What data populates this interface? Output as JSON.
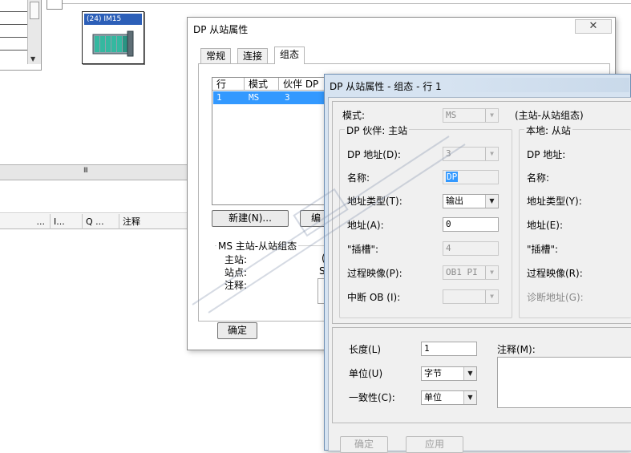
{
  "background": {
    "module_label": "(24) IM15",
    "scroll_grip": "III",
    "table_headers": [
      "...",
      "I...",
      "Q ...",
      "注释"
    ]
  },
  "dp_dialog": {
    "title": "DP 从站属性",
    "close_glyph": "✕",
    "tabs": [
      "常规",
      "连接",
      "组态"
    ],
    "active_tab": "组态",
    "table": {
      "headers": [
        "行",
        "模式",
        "伙伴 DP"
      ],
      "rows": [
        [
          "1",
          "MS",
          "3"
        ]
      ]
    },
    "new_button": "新建(N)...",
    "edit_button": "编",
    "ms_group": {
      "title": "MS 主站-从站组态",
      "master_label": "主站:",
      "station_label": "站点:",
      "comment_label": "注释:",
      "master_value_partial": "(",
      "station_value_partial": "S"
    },
    "ok_button": "确定"
  },
  "row_dialog": {
    "title": "DP 从站属性 - 组态 - 行 1",
    "mode": {
      "label": "模式:",
      "value": "MS",
      "hint": "(主站-从站组态)"
    },
    "dp_partner_group": {
      "title": "DP 伙伴: 主站",
      "dp_address": {
        "label": "DP 地址(D):",
        "value": "3"
      },
      "name": {
        "label": "名称:",
        "value": "DP"
      },
      "address_type": {
        "label": "地址类型(T):",
        "value": "输出"
      },
      "address": {
        "label": "地址(A):",
        "value": "0"
      },
      "slot": {
        "label": "\"插槽\":",
        "value": "4"
      },
      "process_image": {
        "label": "过程映像(P):",
        "value": "OB1 PI"
      },
      "interrupt_ob": {
        "label": "中断 OB (I):",
        "value": ""
      }
    },
    "local_group": {
      "title": "本地: 从站",
      "dp_address_label": "DP 地址:",
      "name_label": "名称:",
      "address_type_label": "地址类型(Y):",
      "address_label": "地址(E):",
      "slot_label": "\"插槽\":",
      "process_image_label": "过程映像(R):",
      "diag_address_label": "诊断地址(G):"
    },
    "length": {
      "label": "长度(L)",
      "value": "1"
    },
    "unit": {
      "label": "单位(U)",
      "value": "字节"
    },
    "consistency": {
      "label": "一致性(C):",
      "value": "单位"
    },
    "comment_label": "注释(M):",
    "ok_button": "确定",
    "apply_button": "应用"
  },
  "colors": {
    "selection": "#3399ff",
    "dialog_frame": "#d6e3f1",
    "module_label": "#2c5fb8"
  }
}
